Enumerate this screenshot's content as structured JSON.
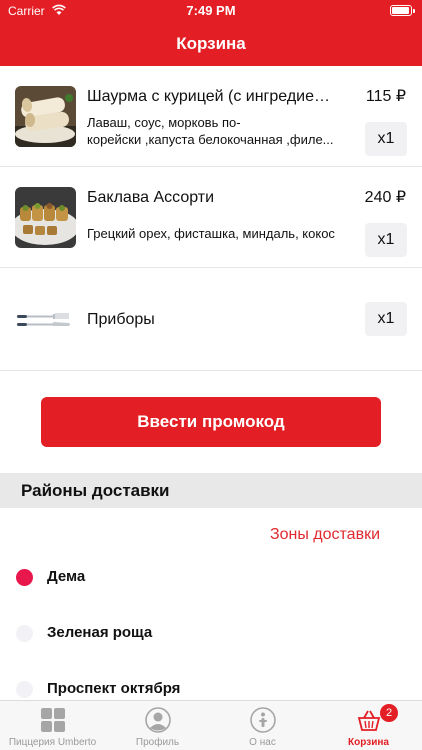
{
  "status_bar": {
    "carrier": "Carrier",
    "time": "7:49 PM"
  },
  "nav": {
    "title": "Корзина"
  },
  "cart_items": [
    {
      "name": "Шаурма с курицей (с ингредиент...",
      "description_line1": "Лаваш, соус, морковь по-",
      "description_line2": "корейски ,капуста белокочанная ,филе...",
      "price": "115 ₽",
      "quantity": "x1",
      "image": "shawarma-photo"
    },
    {
      "name": "Баклава Ассорти",
      "description": "Грецкий орех, фисташка, миндаль, кокос",
      "price": "240 ₽",
      "quantity": "x1",
      "image": "baklava-photo"
    },
    {
      "name": "Приборы",
      "quantity": "x1",
      "image": "cutlery-icon"
    }
  ],
  "promo_button": {
    "label": "Ввести промокод"
  },
  "delivery": {
    "section_title": "Районы доставки",
    "zones_link": "Зоны доставки",
    "districts": [
      {
        "label": "Дема",
        "selected": true
      },
      {
        "label": "Зеленая роща",
        "selected": false
      },
      {
        "label": "Проспект октября",
        "selected": false
      }
    ]
  },
  "tab_bar": {
    "tabs": [
      {
        "label": "Пиццерия Umberto",
        "icon": "grid-icon"
      },
      {
        "label": "Профиль",
        "icon": "profile-icon"
      },
      {
        "label": "О нас",
        "icon": "info-icon"
      },
      {
        "label": "Корзина",
        "icon": "basket-icon",
        "active": true,
        "badge": "2"
      }
    ]
  },
  "colors": {
    "brand_red": "#e31e24",
    "selected_radio": "#e8174c"
  }
}
